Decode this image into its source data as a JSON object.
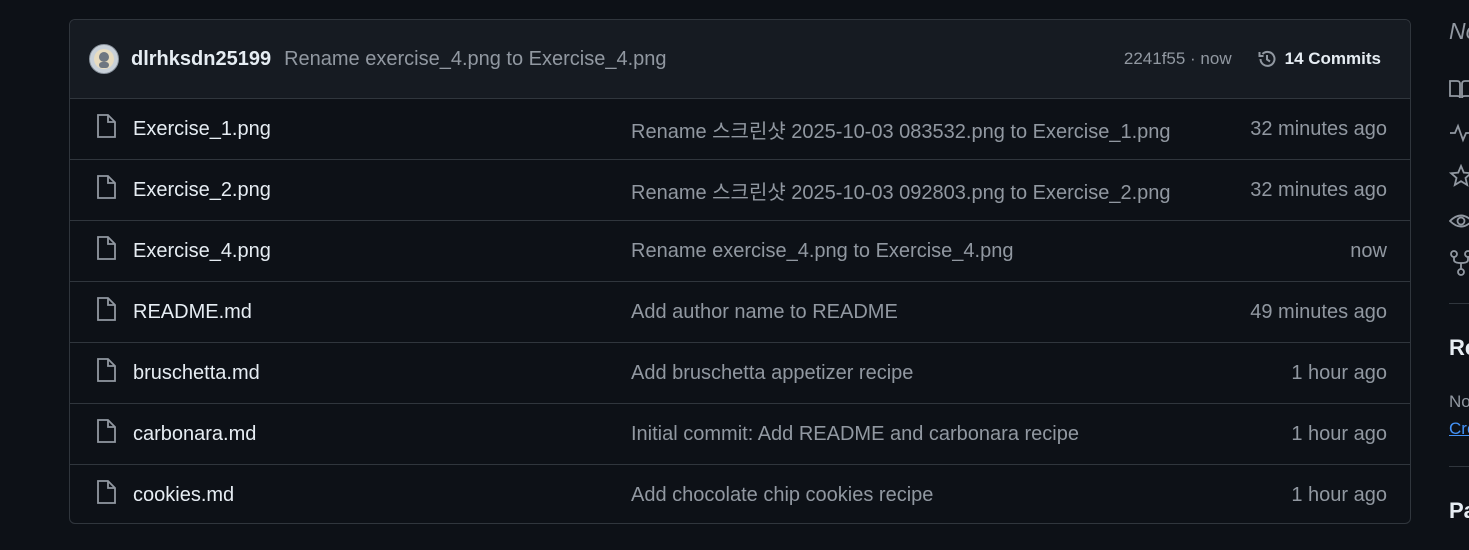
{
  "commit": {
    "author": "dlrhksdn25199",
    "message": "Rename exercise_4.png to Exercise_4.png",
    "meta": "2241f55 · now",
    "commits_label": "14 Commits",
    "avatar_icon": "user-avatar-icon",
    "history_icon": "history-icon"
  },
  "files": [
    {
      "name": "Exercise_1.png",
      "message": "Rename 스크린샷 2025-10-03 083532.png to Exercise_1.png",
      "time": "32 minutes ago",
      "icon": "file-icon"
    },
    {
      "name": "Exercise_2.png",
      "message": "Rename 스크린샷 2025-10-03 092803.png to Exercise_2.png",
      "time": "32 minutes ago",
      "icon": "file-icon"
    },
    {
      "name": "Exercise_4.png",
      "message": "Rename exercise_4.png to Exercise_4.png",
      "time": "now",
      "icon": "file-icon"
    },
    {
      "name": "README.md",
      "message": "Add author name to README",
      "time": "49 minutes ago",
      "icon": "file-icon"
    },
    {
      "name": "bruschetta.md",
      "message": "Add bruschetta appetizer recipe",
      "time": "1 hour ago",
      "icon": "file-icon"
    },
    {
      "name": "carbonara.md",
      "message": "Initial commit: Add README and carbonara recipe",
      "time": "1 hour ago",
      "icon": "file-icon"
    },
    {
      "name": "cookies.md",
      "message": "Add chocolate chip cookies recipe",
      "time": "1 hour ago",
      "icon": "file-icon"
    }
  ],
  "sidebar": {
    "about_text": "No",
    "icons": [
      "book-icon",
      "pulse-icon",
      "star-icon",
      "eye-icon",
      "fork-icon"
    ],
    "releases_heading": "Re",
    "releases_text": "No",
    "releases_link": "Cre",
    "packages_heading": "Pa"
  },
  "colors": {
    "background": "#0d1117",
    "header_bg": "#161b22",
    "border": "#30363d",
    "text": "#e6edf3",
    "muted": "#9198a1",
    "link": "#4493f8"
  }
}
